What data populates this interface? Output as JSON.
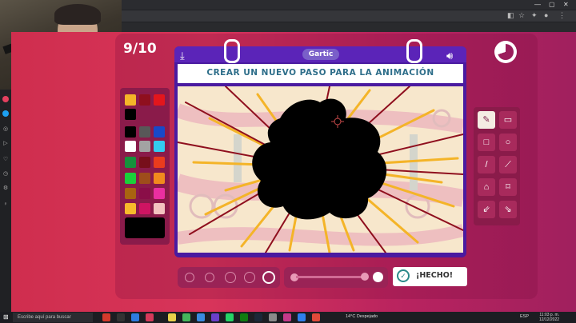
{
  "round": {
    "label": "9/10"
  },
  "card": {
    "logo": "Gartic",
    "title": "CREAR UN NUEVO PASO PARA LA ANIMACIÓN"
  },
  "palette": {
    "colors": [
      "#f4b428",
      "#8f0f1e",
      "#e3161c",
      "#000000",
      "#000000",
      "#585858",
      "#1849c8",
      "#ffffff",
      "#a3a3a3",
      "#33ccf0",
      "#16913c",
      "#770f1b",
      "#ea3c1d",
      "#1ad13a",
      "#9e4d1b",
      "#f18a1e",
      "#a96310",
      "#8a0e48",
      "#ea2fa1",
      "#f7ba2b",
      "#cf1462",
      "#f3c3c0"
    ],
    "selected": "#000000"
  },
  "tools": [
    "✎",
    "▭",
    "□",
    "○",
    "/",
    "⟋",
    "⌂",
    "⌑",
    "⇙",
    "⇘"
  ],
  "done": {
    "label": "¡HECHO!"
  },
  "taskbar": {
    "search_placeholder": "Escribe aquí para buscar",
    "weather": "14°C  Despejado",
    "lang": "ESP",
    "time": "11:03 p. m.",
    "date": "12/12/2022"
  }
}
